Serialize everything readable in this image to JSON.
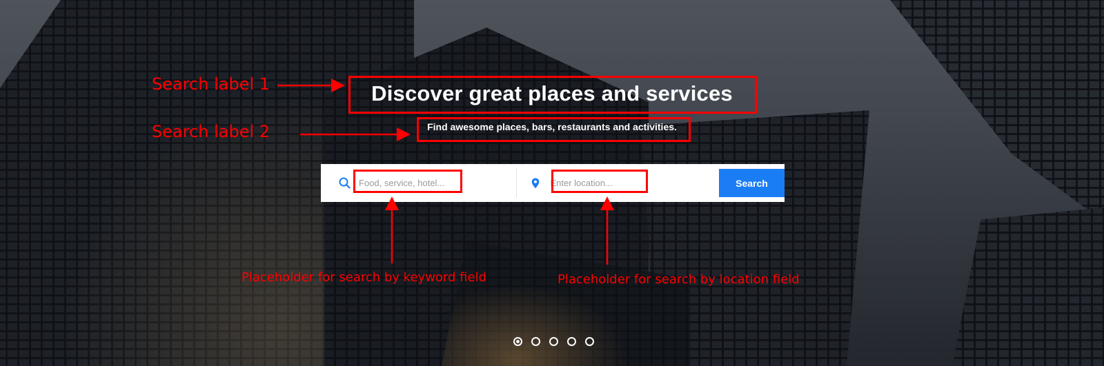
{
  "hero": {
    "title": "Discover great places and services",
    "subtitle": "Find awesome places, bars, restaurants and activities."
  },
  "search": {
    "keyword_placeholder": "Food, service, hotel...",
    "keyword_icon": "search-icon",
    "location_placeholder": "Enter location...",
    "location_icon": "map-pin-icon",
    "button_label": "Search",
    "accent_color": "#1a7df4"
  },
  "slider": {
    "dot_count": 5,
    "active_index": 0
  },
  "annotations": {
    "label_1": "Search label 1",
    "label_2": "Search label 2",
    "keyword_note": "Placeholder for search by keyword field",
    "location_note": "Placeholder for search by location field",
    "color": "#ff0000"
  }
}
